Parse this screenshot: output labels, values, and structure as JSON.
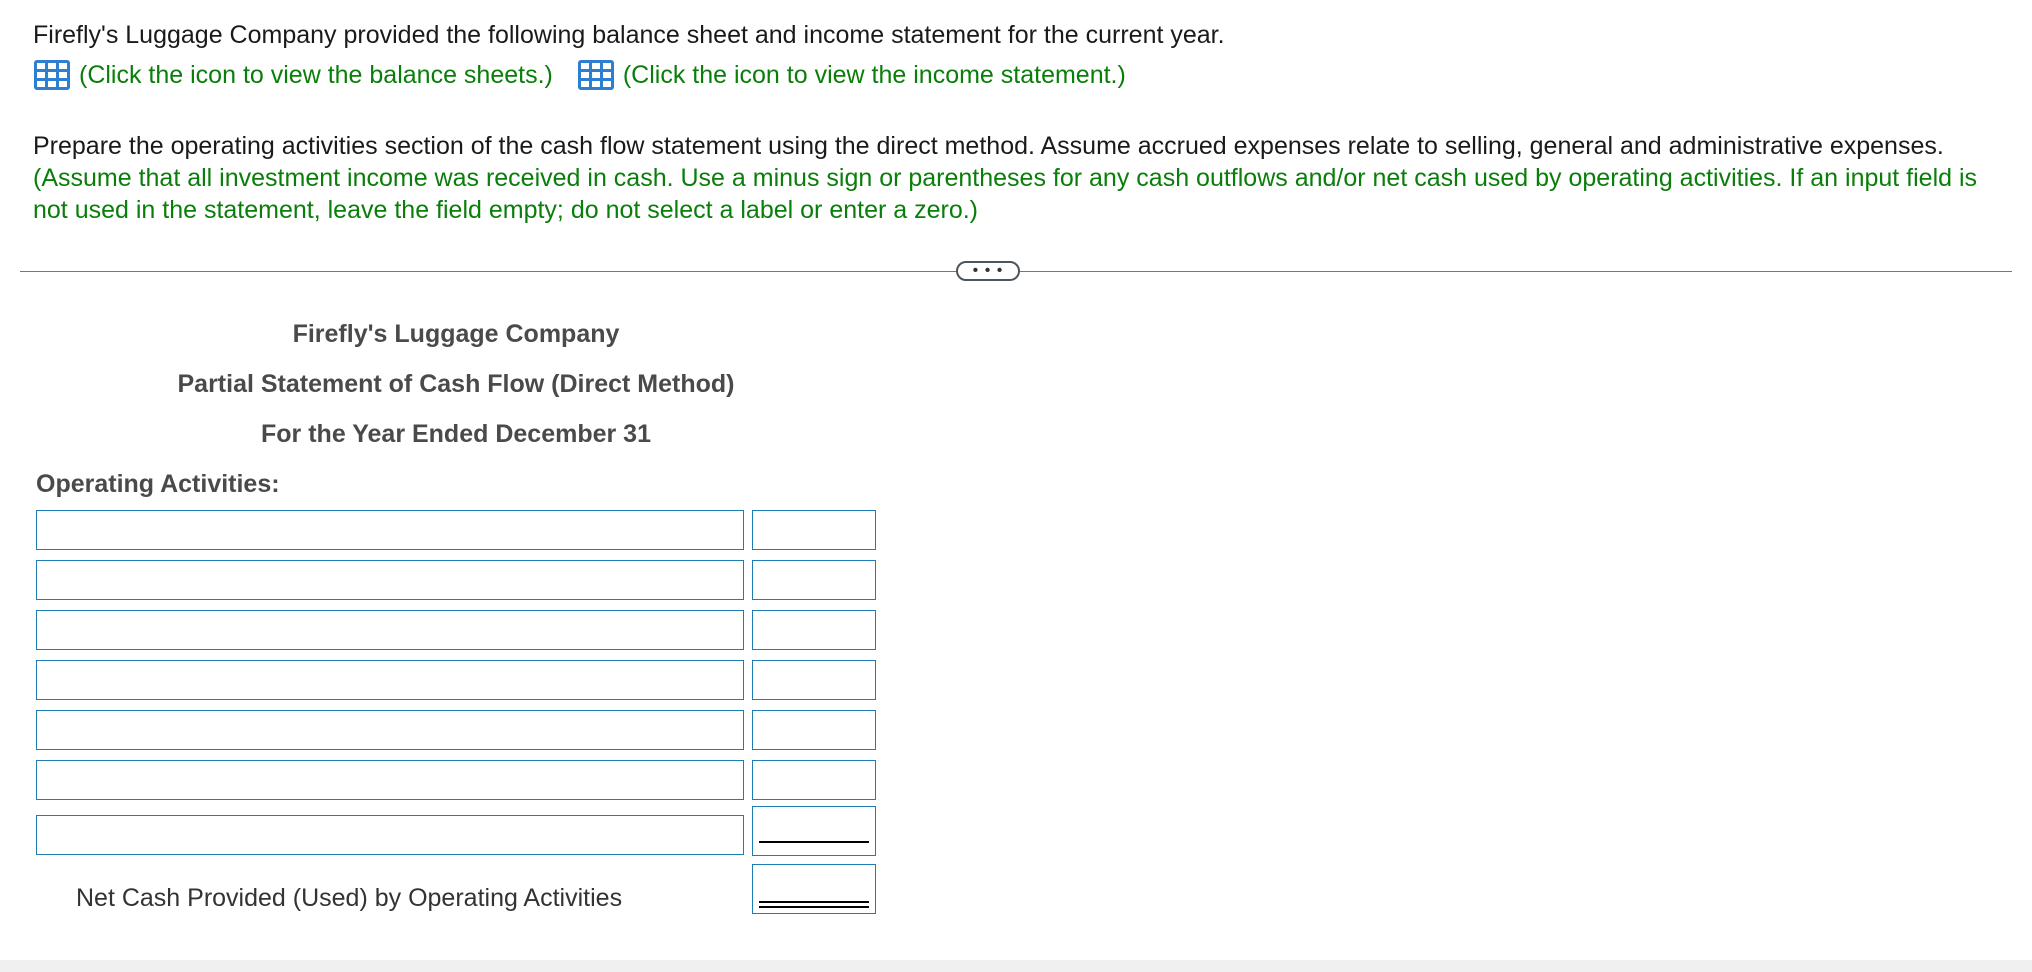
{
  "intro": {
    "text": "Firefly's Luggage Company provided the following balance sheet and income statement for the current year.",
    "balance_link": "(Click the icon to view the balance sheets.)",
    "income_link": "(Click the icon to view the income statement.)"
  },
  "instructions": {
    "main": "Prepare the operating activities section of the cash flow statement using the direct method. Assume accrued expenses relate to selling, general and administrative expenses.",
    "note": "(Assume that all investment income was received in cash. Use a minus sign or parentheses for any cash outflows and/or net cash used by operating activities. If an input field is not used in the statement, leave the field empty; do not select a label or enter a zero.)"
  },
  "divider": {
    "label": "• • •"
  },
  "statement": {
    "company": "Firefly's Luggage Company",
    "title": "Partial Statement of Cash Flow (Direct Method)",
    "period": "For the Year Ended December 31",
    "section": "Operating Activities:",
    "rows": [
      {
        "label": "",
        "amount": ""
      },
      {
        "label": "",
        "amount": ""
      },
      {
        "label": "",
        "amount": ""
      },
      {
        "label": "",
        "amount": ""
      },
      {
        "label": "",
        "amount": ""
      },
      {
        "label": "",
        "amount": ""
      },
      {
        "label": "",
        "amount": ""
      }
    ],
    "net_label": "Net Cash Provided (Used) by Operating Activities",
    "net_amount": ""
  },
  "colors": {
    "link_green": "#0a7e0a",
    "input_border": "#1f7db4",
    "icon_blue": "#2f7fd1"
  },
  "icons": [
    "grid-table-icon"
  ]
}
